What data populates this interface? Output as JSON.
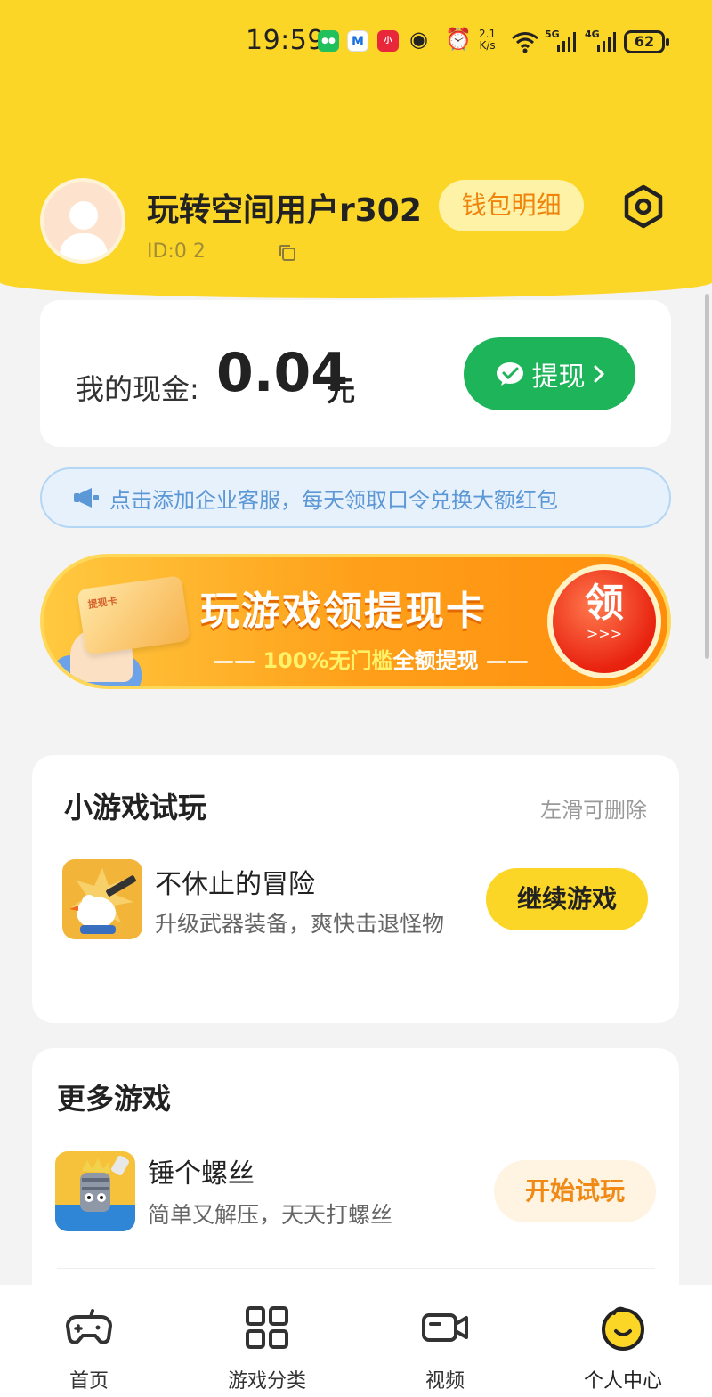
{
  "status_bar": {
    "time": "19:59",
    "net_speed_value": "2.1",
    "net_speed_unit": "K/s",
    "signal_1": "5G",
    "signal_2": "4G",
    "battery": "62"
  },
  "profile": {
    "username": "玩转空间用户r302",
    "user_id": "ID:0        2",
    "wallet_label": "钱包明细"
  },
  "cash": {
    "label": "我的现金:",
    "amount": "0.04",
    "unit": "元",
    "withdraw_label": "提现"
  },
  "notice": {
    "text": "点击添加企业客服，每天领取口令兑换大额红包"
  },
  "banner": {
    "card_text": "提现卡",
    "title": "玩游戏领提现卡",
    "subtitle_highlight": "100%无门槛",
    "subtitle_rest": "全额提现",
    "claim_label": "领",
    "claim_arrows": ">>>"
  },
  "trial_section": {
    "title": "小游戏试玩",
    "hint": "左滑可删除",
    "game": {
      "name": "不休止的冒险",
      "desc": "升级武器装备，爽快击退怪物",
      "button": "继续游戏"
    }
  },
  "more_section": {
    "title": "更多游戏",
    "game": {
      "name": "锤个螺丝",
      "desc": "简单又解压，天天打螺丝",
      "button": "开始试玩"
    }
  },
  "nav": [
    {
      "label": "首页",
      "icon": "gamepad-icon"
    },
    {
      "label": "游戏分类",
      "icon": "grid-icon"
    },
    {
      "label": "视频",
      "icon": "video-icon"
    },
    {
      "label": "个人中心",
      "icon": "profile-face-icon",
      "active": true
    }
  ],
  "colors": {
    "header": "#fcd626",
    "withdraw": "#1db45a",
    "accent_orange": "#f0830c"
  }
}
